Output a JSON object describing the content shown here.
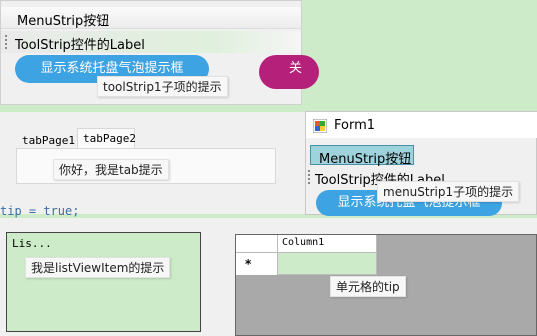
{
  "panel1": {
    "menu_label": "MenuStrip按钮",
    "toolstrip_label": "ToolStrip控件的Label",
    "balloon_button": "显示系统托盘气泡提示框",
    "purple_button_partial": "关",
    "tooltip": "toolStrip1子项的提示"
  },
  "tabs": {
    "tab1": "tabPage1",
    "tab2": "tabPage2",
    "tooltip": "你好，我是tab提示"
  },
  "code_fragment": "tip  = true;",
  "form1": {
    "title": "Form1",
    "menu_button": "MenuStrip按钮",
    "toolstrip_label": "ToolStrip控件的Label",
    "tooltip": "menuStrip1子项的提示",
    "balloon_button": "显示系统托盘气泡提示框"
  },
  "listview": {
    "item": "Lis...",
    "tooltip": "我是listViewItem的提示"
  },
  "grid": {
    "column_header": "Column1",
    "row_marker": "*",
    "tooltip": "单元格的tip"
  },
  "colors": {
    "background": "#cdebc8",
    "blue_button": "#3ea3e2",
    "purple_button": "#b5207a",
    "selected_menu": "#9fd3dc"
  }
}
